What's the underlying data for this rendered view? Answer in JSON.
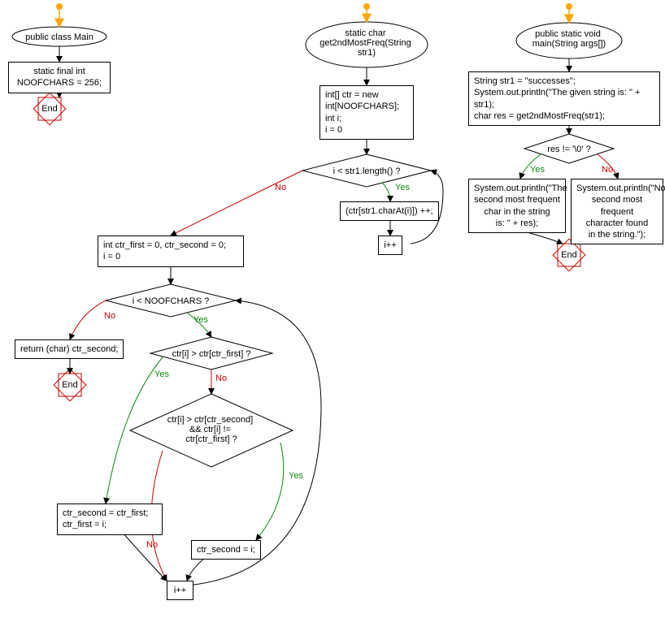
{
  "flowchart": {
    "section1": {
      "start": "public class Main",
      "box": "static final int\nNOOFCHARS = 256;",
      "end": "End"
    },
    "section2": {
      "start": "static char\nget2ndMostFreq(String\nstr1)",
      "box1": "int[] ctr = new\nint[NOOFCHARS];\nint i;\ni = 0",
      "dec1": "i < str1.length() ?",
      "box_inc": "(ctr[str1.charAt(i)]) ++;",
      "box_ipp": "i++",
      "box2": "int ctr_first = 0, ctr_second = 0;\ni = 0",
      "dec2": "i < NOOFCHARS ?",
      "box_ret": "return (char) ctr_second;",
      "end": "End",
      "dec3": "ctr[i] > ctr[ctr_first] ?",
      "dec4": "ctr[i] > ctr[ctr_second]\n&& ctr[i] !=\nctr[ctr_first] ?",
      "box_a": "ctr_second = ctr_first;\nctr_first = i;",
      "box_b": "ctr_second = i;",
      "box_ipp2": "i++"
    },
    "section3": {
      "start": "public static void\nmain(String args[])",
      "box1": "String str1 = \"successes\";\nSystem.out.println(\"The given string is: \" + str1);\nchar res = get2ndMostFreq(str1);",
      "dec": "res != '\\0' ?",
      "box_yes": "System.out.println(\"The\nsecond most frequent\nchar in the string\nis: \" + res);",
      "box_no": "System.out.println(\"No\nsecond most frequent\ncharacter found\nin the string.\");",
      "end": "End"
    },
    "labels": {
      "yes": "Yes",
      "no": "No"
    }
  }
}
